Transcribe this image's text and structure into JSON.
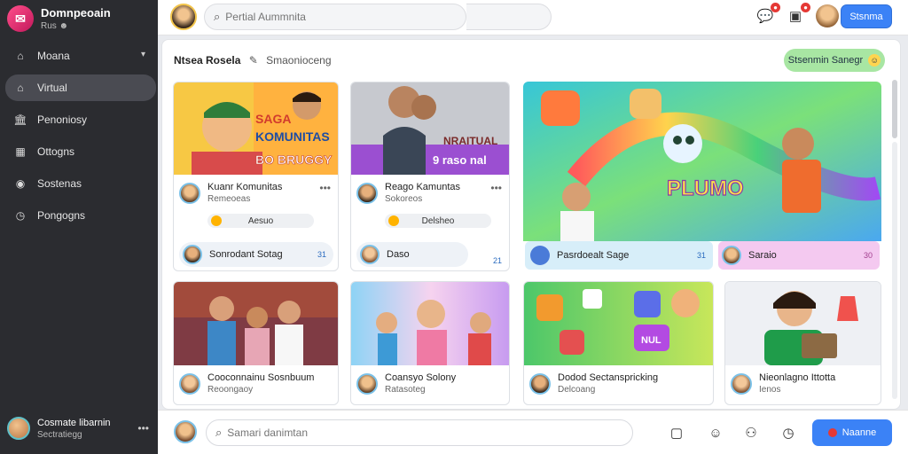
{
  "brand": {
    "title": "Domnpeoain",
    "subtitle": "Rus ☻"
  },
  "sidebar": {
    "items": [
      {
        "label": "Moana",
        "icon": "home-icon",
        "active": false,
        "chevron": true
      },
      {
        "label": "Virtual",
        "icon": "home-icon",
        "active": true,
        "chevron": false
      },
      {
        "label": "Penoniosy",
        "icon": "bank-icon",
        "active": false,
        "chevron": false
      },
      {
        "label": "Ottogns",
        "icon": "grid-icon",
        "active": false,
        "chevron": false
      },
      {
        "label": "Sostenas",
        "icon": "globe-icon",
        "active": false,
        "chevron": false
      },
      {
        "label": "Pongogns",
        "icon": "clock-icon",
        "active": false,
        "chevron": false
      }
    ],
    "profile": {
      "name": "Cosmate libarnin",
      "subtitle": "Sectratiegg"
    }
  },
  "topbar": {
    "search_placeholder": "Pertial Aummnita",
    "button_label": "Stsnma"
  },
  "page": {
    "title": "Ntsea Rosela",
    "title_secondary": "Smaonioceng",
    "action_label": "Stsenmin Sanegr"
  },
  "cards": [
    {
      "thumb_title_1": "SAGA",
      "thumb_title_2": "KOMUNITAS",
      "thumb_title_3": "BO BRUGGY",
      "author": "Kuanr Komunitas",
      "author_sub": "Remeoeas",
      "tag": "Aesuo",
      "comment": "Sonrodant Sotag",
      "count": "31"
    },
    {
      "thumb_title_1": "NRAITUAL",
      "thumb_title_2": "9 raso nal",
      "author": "Reago Kamuntas",
      "author_sub": "Sokoreos",
      "tag": "Delsheo",
      "comment": "Daso",
      "count": "21"
    },
    {
      "thumb_title_1": "PLUMO",
      "comment_left": "Pasrdoealt Sage",
      "count_left": "31",
      "comment_right": "Saraio",
      "count_right": "30"
    },
    {
      "author": "Cooconnainu Sosnbuum",
      "author_sub": "Reoongaoy"
    },
    {
      "author": "Coansyo Solony",
      "author_sub": "Ratasoteg"
    },
    {
      "thumb_title_1": "NUL",
      "author": "Dodod Sectanspricking",
      "author_sub": "Delcoang"
    },
    {
      "author": "Nieonlagno Ittotta",
      "author_sub": "Ienos"
    }
  ],
  "bottombar": {
    "input_placeholder": "Samari danimtan",
    "button_label": "Naanne"
  }
}
